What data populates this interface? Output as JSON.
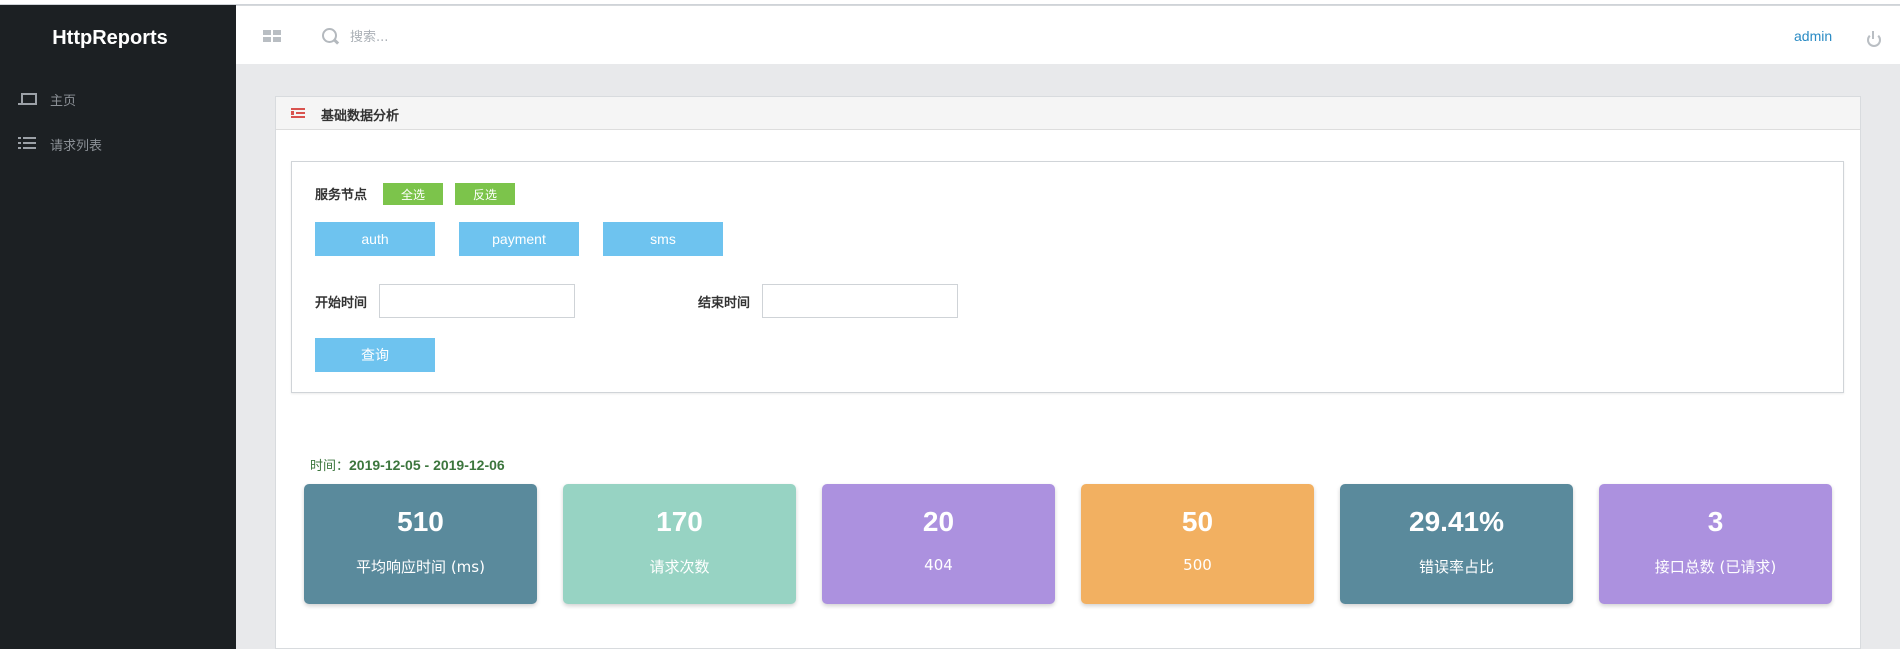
{
  "app": {
    "brand": "HttpReports"
  },
  "sidebar": {
    "items": [
      {
        "label": "主页",
        "icon": "laptop-icon"
      },
      {
        "label": "请求列表",
        "icon": "list-icon"
      }
    ]
  },
  "topbar": {
    "search_placeholder": "搜索...",
    "user": "admin"
  },
  "panel": {
    "title": "基础数据分析",
    "service_label": "服务节点",
    "select_all": "全选",
    "invert_select": "反选",
    "services": [
      "auth",
      "payment",
      "sms"
    ],
    "start_label": "开始时间",
    "end_label": "结束时间",
    "start_value": "",
    "end_value": "",
    "query_label": "查询"
  },
  "summary": {
    "time_prefix": "时间：",
    "time_range": "2019-12-05 - 2019-12-06"
  },
  "stats": [
    {
      "value": "510",
      "label": "平均响应时间 (ms)",
      "color": "#5a8a9c"
    },
    {
      "value": "170",
      "label": "请求次数",
      "color": "#97d3c3"
    },
    {
      "value": "20",
      "label": "404",
      "color": "#ac91df"
    },
    {
      "value": "50",
      "label": "500",
      "color": "#f2b061"
    },
    {
      "value": "29.41%",
      "label": "错误率占比",
      "color": "#5a8a9c"
    },
    {
      "value": "3",
      "label": "接口总数 (已请求)",
      "color": "#ac91df"
    }
  ],
  "colors": {
    "sidebar_bg": "#1c2023",
    "accent_blue": "#6ec3ef",
    "accent_green": "#7cc44b",
    "link": "#2a8bc4"
  }
}
